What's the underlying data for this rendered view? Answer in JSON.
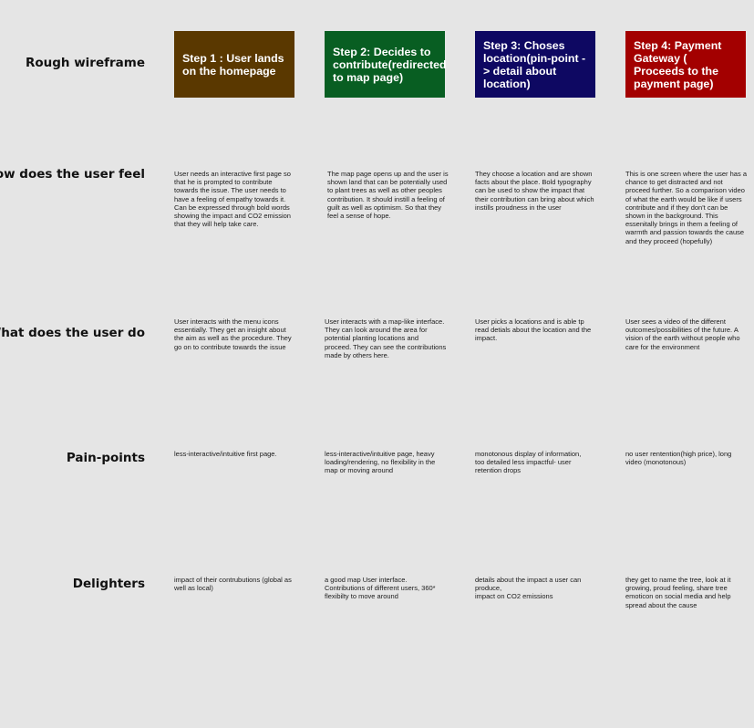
{
  "rows": {
    "wireframe": "Rough wireframe",
    "feel": "How does the user feel",
    "do": "What does the user do",
    "pain": "Pain-points",
    "delight": "Delighters"
  },
  "steps": [
    {
      "title": "Step 1 : User lands on the homepage",
      "color": "#5a3800",
      "feel": "User needs an interactive first page so that he is prompted to contribute towards the issue. The user needs to have a feeling of empathy towards it. Can be expressed through bold words showing the impact and CO2 emission that they will help take care.",
      "do": "User interacts with the menu icons essentially. They get an insight about the aim as well as the procedure. They go on to contribute towards the issue",
      "pain": "less-interactive/intuitive first page.",
      "delight": "impact of their contrubutions (global as well as local)"
    },
    {
      "title": "Step 2: Decides to contribute(redirected to map page)",
      "color": "#085e22",
      "feel": "The map page opens up and the user is shown land that can be potentially used to plant trees as well as other peoples contribution. It should instill a feeling of guilt as well as optimism. So that they feel a sense of hope.",
      "do": "User  interacts with a map-like interface. They can look around the area for potential planting locations and proceed. They can see the contributions made by others here.",
      "pain": "less-interactive/intuitive page, heavy loading/rendering, no flexibility in the map or moving around",
      "delight": "a good map User interface.\nContributions of different users, 360*\nflexibilty to move around"
    },
    {
      "title": "Step 3: Choses location(pin-point -> detail about location)",
      "color": "#0e0862",
      "feel": "They choose a location and are shown facts about the place. Bold typography can be used to show the impact that their contribution can bring about which instills proudness in the user",
      "do": "User picks a locations and is able tp read detials about the location and the impact.",
      "pain": "monotonous display of information,\ntoo detailed less impactful- user retention drops",
      "delight": "details about the impact a user can produce,\nimpact on CO2 emissions"
    },
    {
      "title": "Step 4: Payment Gateway ( Proceeds to the payment page)",
      "color": "#a30000",
      "feel": "This is one screen where the user has a chance to get distracted and not proceed further. So a comparison video of what the earth would be like if users contribute and if they don't can be shown in the background. This essenitally brings in them a feeling of warmth and passion towards the cause and they proceed (hopefully)",
      "do": "User sees a video of the different outcomes/possibilities of the future. A vision of the earth without people who care for the environment",
      "pain": "no user rentention(high price), long video (monotonous)",
      "delight": "they get to name the tree, look at it growing, proud feeling, share tree emoticon on social media and help spread about the cause"
    }
  ]
}
